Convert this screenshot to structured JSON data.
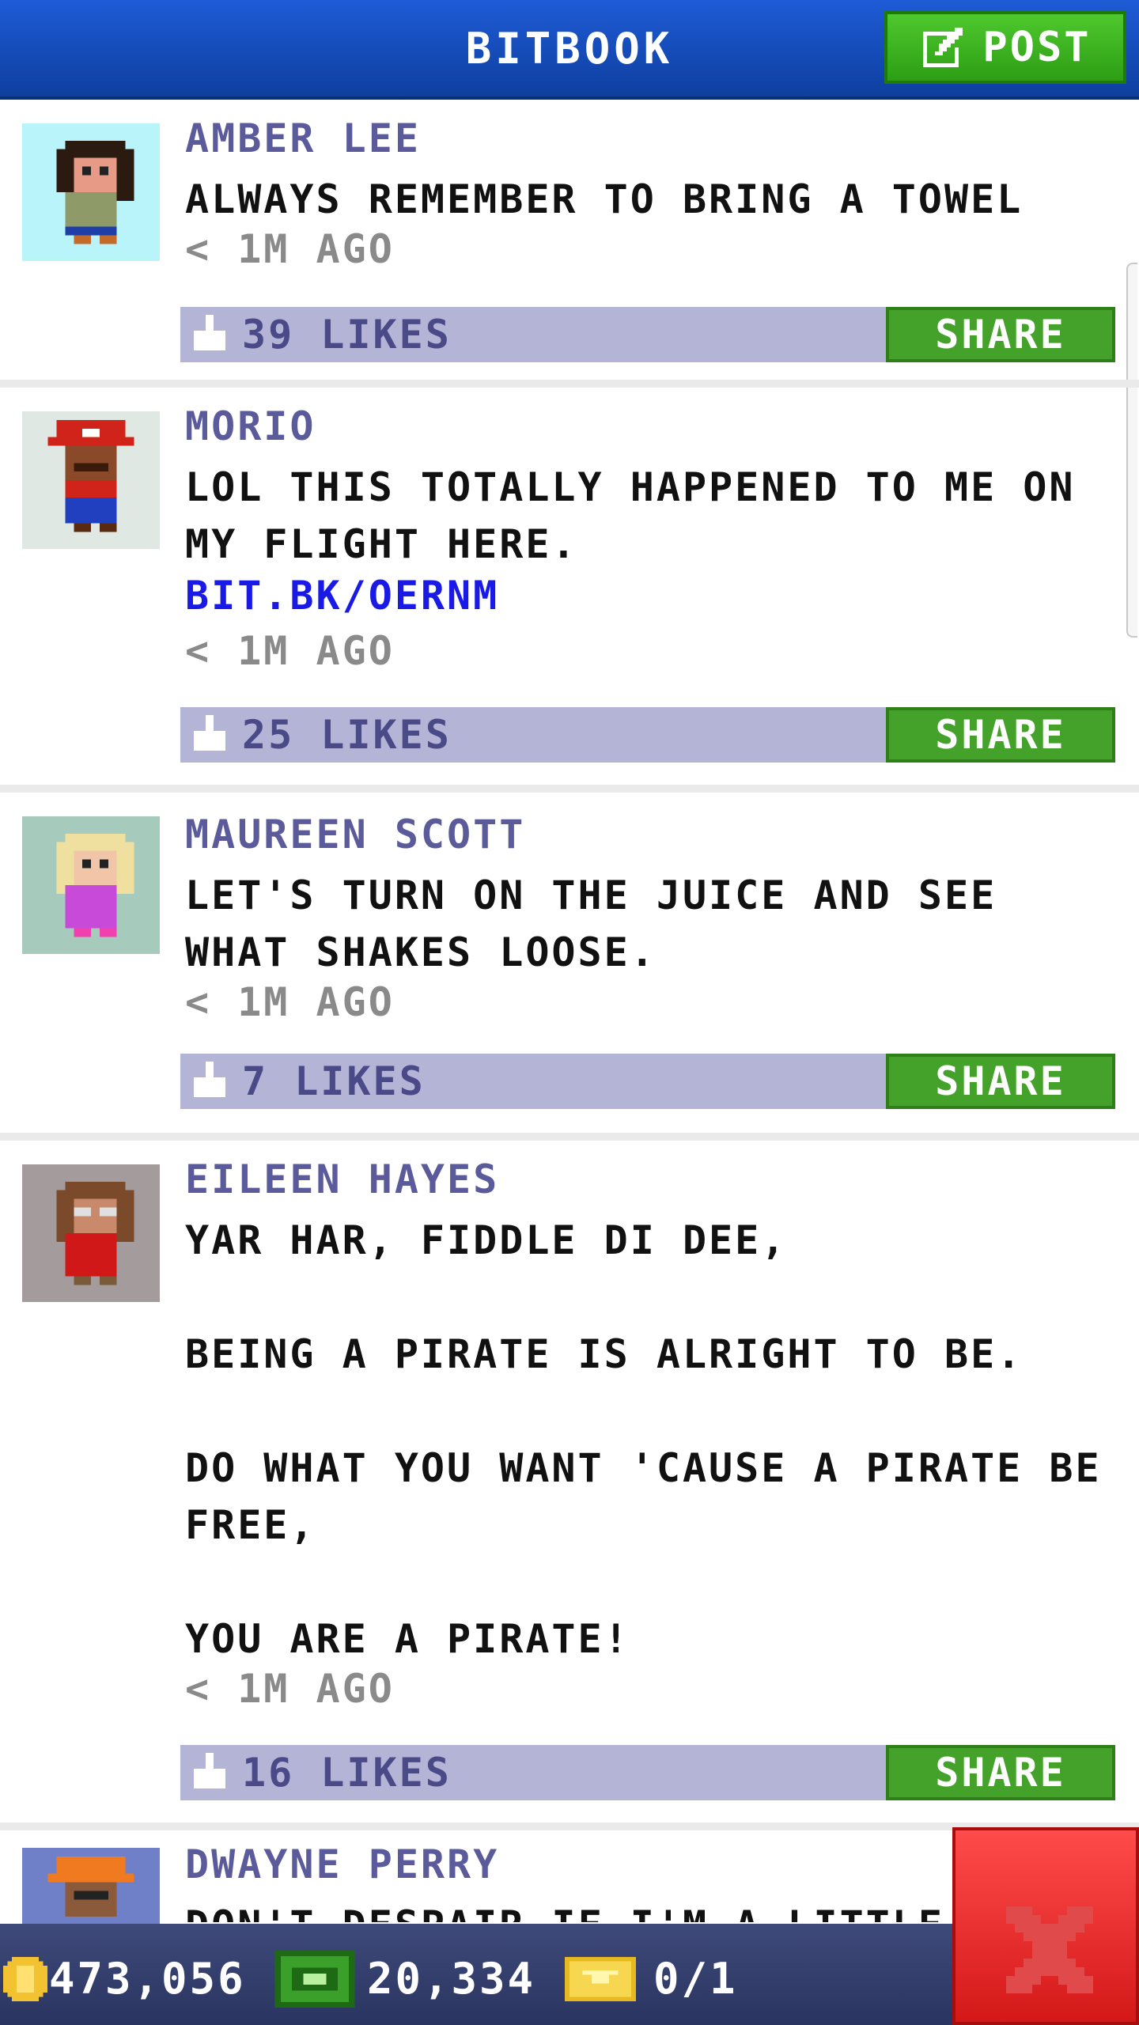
{
  "header": {
    "title": "BITBOOK",
    "post_label": "POST"
  },
  "posts": [
    {
      "author": "AMBER LEE",
      "text": "ALWAYS REMEMBER TO BRING A TOWEL",
      "time": "< 1M AGO",
      "likes": "39 LIKES",
      "share_label": "SHARE",
      "avatar": "avatar-amber-lee"
    },
    {
      "author": "MORIO",
      "text": "LOL THIS TOTALLY HAPPENED TO ME ON MY FLIGHT HERE.",
      "link": "BIT.BK/OERNM",
      "time": "< 1M AGO",
      "likes": "25 LIKES",
      "share_label": "SHARE",
      "avatar": "avatar-morio"
    },
    {
      "author": "MAUREEN SCOTT",
      "text": "LET'S TURN ON THE JUICE AND SEE WHAT SHAKES LOOSE.",
      "time": "< 1M AGO",
      "likes": "7 LIKES",
      "share_label": "SHARE",
      "avatar": "avatar-maureen-scott"
    },
    {
      "author": "EILEEN HAYES",
      "text": "YAR HAR, FIDDLE DI DEE,\n\nBEING A PIRATE IS ALRIGHT TO BE.\n\nDO WHAT YOU WANT 'CAUSE A PIRATE BE FREE,\n\nYOU ARE A PIRATE!",
      "time": "< 1M AGO",
      "likes": "16 LIKES",
      "share_label": "SHARE",
      "avatar": "avatar-eileen-hayes"
    },
    {
      "author": "DWAYNE PERRY",
      "text": "DON'T DESPAIR IF I'M A LITTLE BIT",
      "avatar": "avatar-dwayne-perry"
    }
  ],
  "bottom_bar": {
    "coins": "473,056",
    "cash": "20,334",
    "tickets": "0/1"
  },
  "icons": {
    "post": "edit-icon",
    "like": "thumbs-up-icon",
    "coin": "coin-icon",
    "cash": "cash-icon",
    "ticket": "ticket-icon",
    "close": "close-icon"
  },
  "colors": {
    "header": "#1a52c7",
    "post_button": "#3bb51f",
    "share_button": "#44a22b",
    "likes_bar": "#b4b4d6",
    "author": "#5b5b9b",
    "link": "#1a1ae6",
    "close_button": "#e52626"
  }
}
